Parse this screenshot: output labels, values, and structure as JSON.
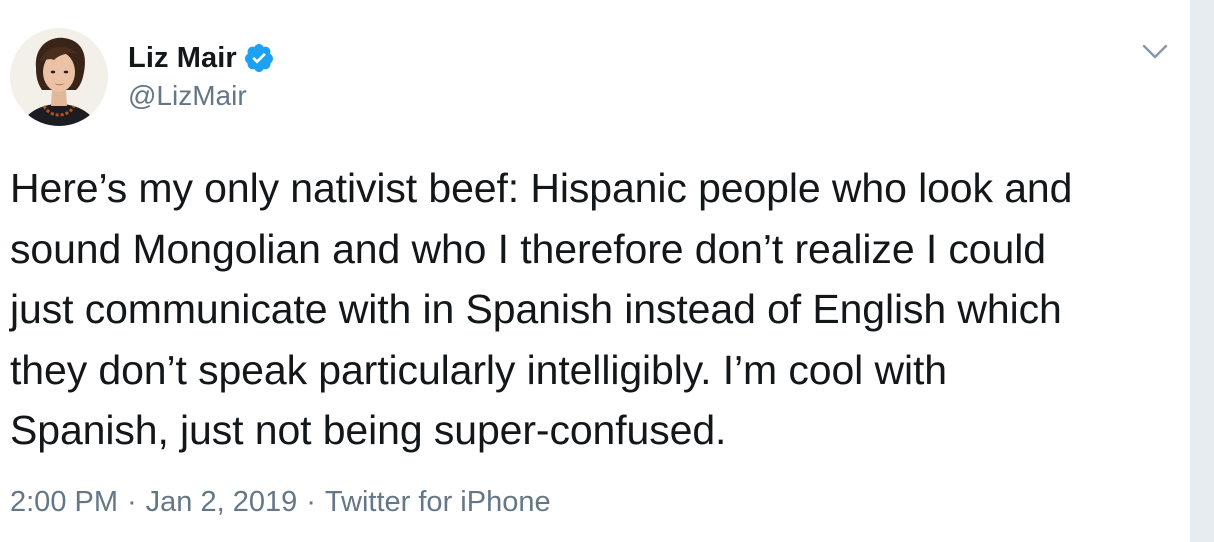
{
  "user": {
    "display_name": "Liz Mair",
    "handle": "@LizMair",
    "verified": true
  },
  "tweet": {
    "text": "Here’s my only nativist beef: Hispanic people who look and\nsound Mongolian and who I therefore don’t realize I could\njust communicate with in Spanish instead of English which\nthey don’t speak particularly intelligibly. I’m cool with\nSpanish, just not being super-confused.",
    "time": "2:00 PM",
    "date": "Jan 2, 2019",
    "source": "Twitter for iPhone",
    "separator": "·"
  },
  "icons": {
    "verified": "verified-badge-icon",
    "menu": "chevron-down-icon",
    "avatar": "avatar"
  },
  "colors": {
    "text": "#14171a",
    "muted": "#657786",
    "verified_blue": "#1da1f2",
    "side_panel": "#e6ecf0"
  }
}
